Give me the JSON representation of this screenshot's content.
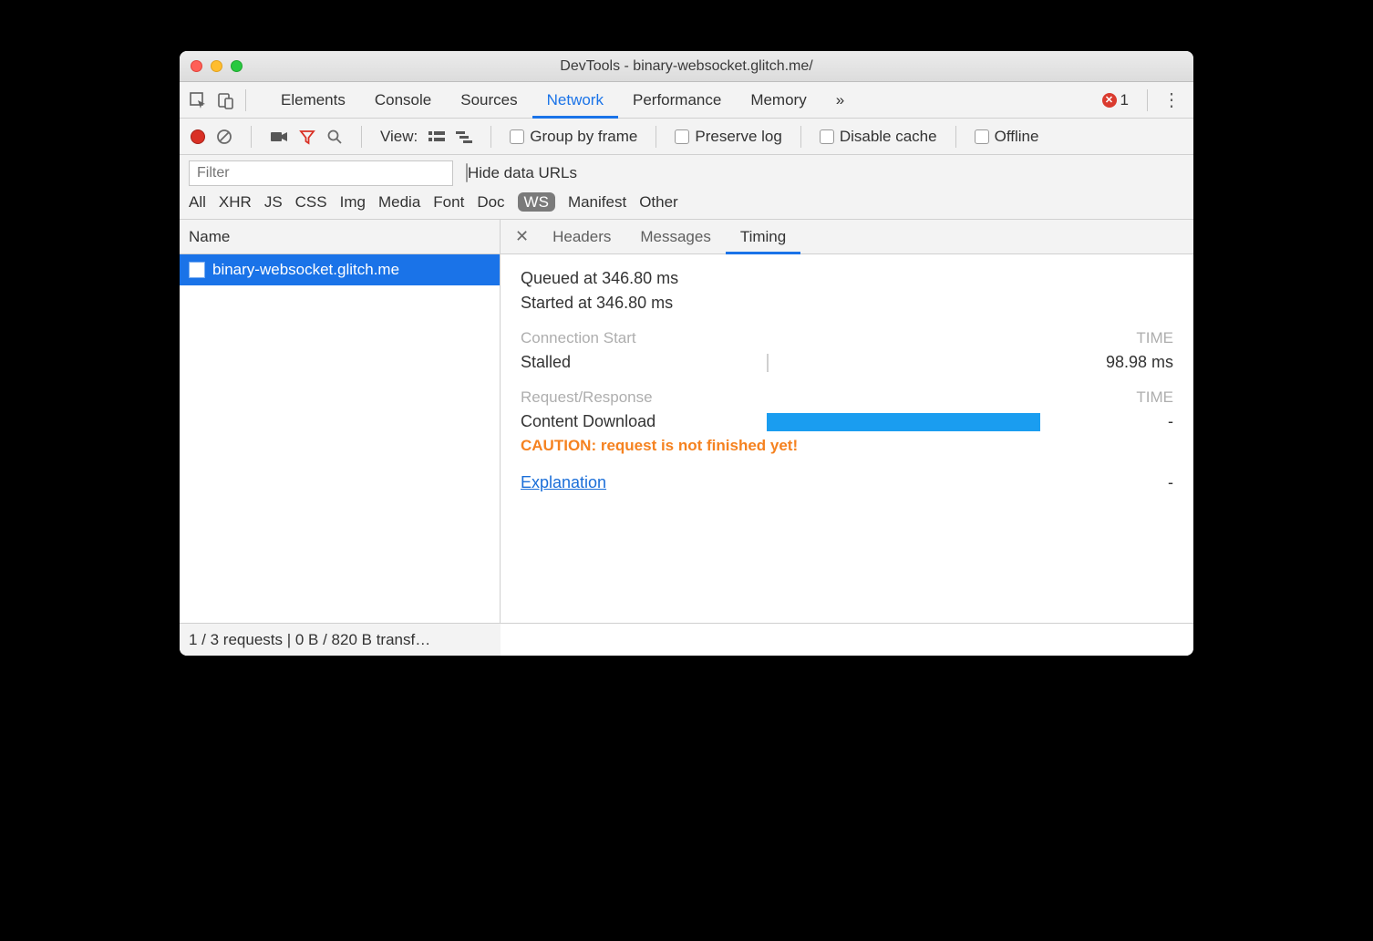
{
  "window": {
    "title": "DevTools - binary-websocket.glitch.me/"
  },
  "panelTabs": {
    "items": [
      "Elements",
      "Console",
      "Sources",
      "Network",
      "Performance",
      "Memory"
    ],
    "active": "Network",
    "overflow": "»"
  },
  "errors": {
    "count": "1"
  },
  "toolbar": {
    "viewLabel": "View:",
    "groupByFrame": "Group by frame",
    "preserveLog": "Preserve log",
    "disableCache": "Disable cache",
    "offline": "Offline"
  },
  "filter": {
    "placeholder": "Filter",
    "hideDataUrls": "Hide data URLs",
    "types": [
      "All",
      "XHR",
      "JS",
      "CSS",
      "Img",
      "Media",
      "Font",
      "Doc",
      "WS",
      "Manifest",
      "Other"
    ],
    "activeType": "WS"
  },
  "nameHeader": "Name",
  "requests": [
    {
      "name": "binary-websocket.glitch.me",
      "selected": true
    }
  ],
  "detailTabs": {
    "items": [
      "Headers",
      "Messages",
      "Timing"
    ],
    "active": "Timing"
  },
  "timing": {
    "queued": "Queued at 346.80 ms",
    "started": "Started at 346.80 ms",
    "connHeader": "Connection Start",
    "timeHeader": "TIME",
    "stalledLabel": "Stalled",
    "stalledValue": "98.98 ms",
    "reqHeader": "Request/Response",
    "contentLabel": "Content Download",
    "contentValue": "-",
    "caution": "CAUTION: request is not finished yet!",
    "explanation": "Explanation",
    "explanationValue": "-"
  },
  "status": "1 / 3 requests | 0 B / 820 B transf…"
}
